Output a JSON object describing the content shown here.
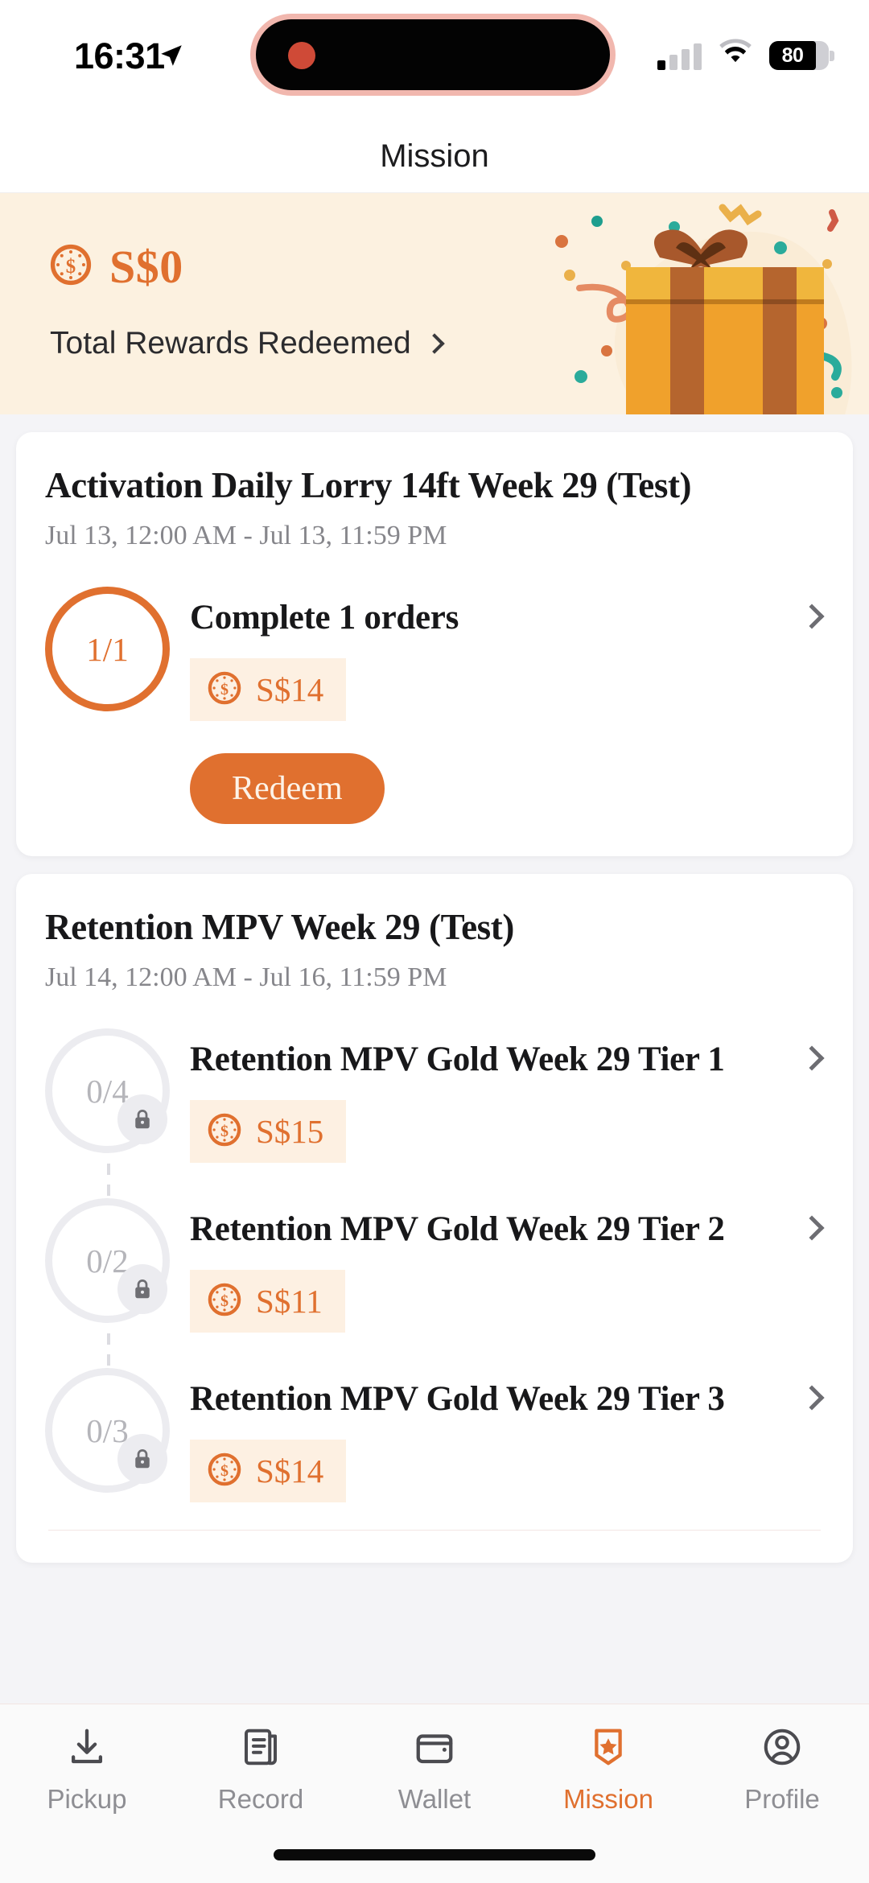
{
  "status_bar": {
    "time": "16:31",
    "location_icon": "location-arrow-icon",
    "signal_icon": "cellular-signal-icon",
    "signal_bars_filled": 1,
    "wifi_icon": "wifi-icon",
    "battery_level": "80",
    "battery_icon": "battery-icon",
    "dynamic_island_indicator": "recording-dot"
  },
  "nav": {
    "title": "Mission"
  },
  "banner": {
    "coin_icon": "coin-dollar-icon",
    "amount": "S$0",
    "label": "Total Rewards Redeemed",
    "chevron_icon": "chevron-right-icon",
    "gift_icon": "gift-box-illustration",
    "bg_color": "#fcf1e0",
    "accent_color": "#e0702f"
  },
  "missions": [
    {
      "title": "Activation Daily Lorry 14ft Week 29 (Test)",
      "date_range": "Jul 13, 12:00 AM - Jul 13, 11:59 PM",
      "tasks": [
        {
          "progress": "1/1",
          "name": "Complete 1 orders",
          "reward": "S$14",
          "locked": false,
          "chevron_icon": "chevron-right-icon",
          "coin_icon": "coin-dollar-icon"
        }
      ],
      "action_label": "Redeem",
      "has_action": true
    },
    {
      "title": "Retention MPV Week 29 (Test)",
      "date_range": "Jul 14, 12:00 AM - Jul 16, 11:59 PM",
      "tasks": [
        {
          "progress": "0/4",
          "name": "Retention MPV Gold Week 29 Tier 1",
          "reward": "S$15",
          "locked": true,
          "lock_icon": "lock-icon",
          "chevron_icon": "chevron-right-icon",
          "coin_icon": "coin-dollar-icon"
        },
        {
          "progress": "0/2",
          "name": "Retention MPV Gold Week 29 Tier 2",
          "reward": "S$11",
          "locked": true,
          "lock_icon": "lock-icon",
          "chevron_icon": "chevron-right-icon",
          "coin_icon": "coin-dollar-icon"
        },
        {
          "progress": "0/3",
          "name": "Retention MPV Gold Week 29 Tier 3",
          "reward": "S$14",
          "locked": true,
          "lock_icon": "lock-icon",
          "chevron_icon": "chevron-right-icon",
          "coin_icon": "coin-dollar-icon"
        }
      ],
      "has_action": false
    }
  ],
  "tabbar": {
    "items": [
      {
        "label": "Pickup",
        "icon": "download-tray-icon",
        "active": false
      },
      {
        "label": "Record",
        "icon": "document-list-icon",
        "active": false
      },
      {
        "label": "Wallet",
        "icon": "wallet-icon",
        "active": false
      },
      {
        "label": "Mission",
        "icon": "badge-star-icon",
        "active": true
      },
      {
        "label": "Profile",
        "icon": "person-circle-icon",
        "active": false
      }
    ],
    "active_color": "#e0702f",
    "inactive_color": "#8e8e93"
  }
}
